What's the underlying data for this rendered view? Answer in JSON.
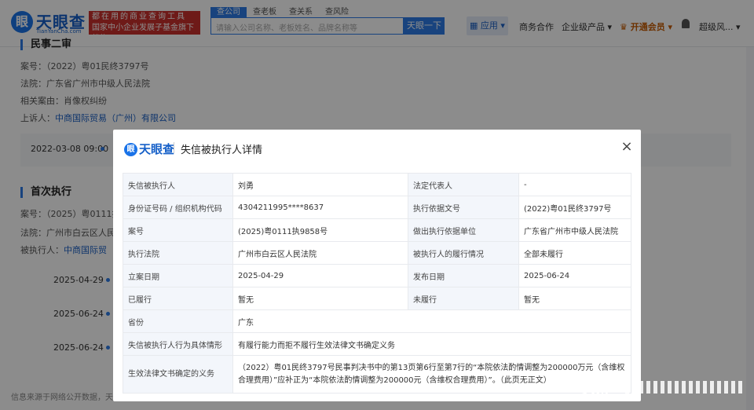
{
  "header": {
    "logo_mark": "眼",
    "logo_text": "天眼查",
    "logo_sub": "TianYanCha.com",
    "slogan_line1": "都在用的商业查询工具",
    "slogan_line2": "国家中小企业发展子基金旗下机构",
    "search_tabs": [
      "查公司",
      "查老板",
      "查关系",
      "查风险"
    ],
    "search_placeholder": "请输入公司名称、老板姓名、品牌名称等",
    "search_button": "天眼一下",
    "nav_apps": "应用",
    "nav_business": "商务合作",
    "nav_enterprise": "企业级产品",
    "nav_vip": "开通会员",
    "nav_user": "超级风..."
  },
  "background": {
    "section1_title": "民事二审",
    "case_no_label": "案号：",
    "case_no": "（2022）粤01民终3797号",
    "court_label": "法院：",
    "court": "广东省广州市中级人民法院",
    "cause_label": "相关案由：",
    "cause": "肖像权纠纷",
    "appellant_label": "上诉人：",
    "appellant": "中商国际贸易（广州）有限公司",
    "time1": "2022-03-08 09:00",
    "section2_title": "首次执行",
    "case_no2": "（2025）粤0111执",
    "court2": "广州市白云区人民",
    "executee_label": "被执行人：",
    "executee": "中商国际贸",
    "dates": [
      "2025-04-29",
      "2025-06-24",
      "2025-06-24"
    ],
    "footer": "信息来源于网络公开数据，天眼查"
  },
  "modal": {
    "logo": "天眼查",
    "title": "失信被执行人详情",
    "close": "×",
    "rows": [
      {
        "k1": "失信被执行人",
        "v1": "刘勇",
        "k2": "法定代表人",
        "v2": "-"
      },
      {
        "k1": "身份证号码 / 组织机构代码",
        "v1": "4304211995****8637",
        "k2": "执行依据文号",
        "v2": "(2022)粤01民终3797号"
      },
      {
        "k1": "案号",
        "v1": "(2025)粤0111执9858号",
        "k2": "做出执行依据单位",
        "v2": "广东省广州市中级人民法院"
      },
      {
        "k1": "执行法院",
        "v1": "广州市白云区人民法院",
        "k2": "被执行人的履行情况",
        "v2": "全部未履行"
      },
      {
        "k1": "立案日期",
        "v1": "2025-04-29",
        "k2": "发布日期",
        "v2": "2025-06-24"
      },
      {
        "k1": "已履行",
        "v1": "暂无",
        "k2": "未履行",
        "v2": "暂无"
      }
    ],
    "province_label": "省份",
    "province": "广东",
    "behavior_label": "失信被执行人行为具体情形",
    "behavior": "有履行能力而拒不履行生效法律文书确定义务",
    "obligation_label": "生效法律文书确定的义务",
    "obligation": "（2022）粤01民终3797号民事判决书中的第13页第6行至第7行的“本院依法酌情调整为200000万元（含维权合理费用）”应补正为“本院依法酌情调整为200000元（含维权合理费用）”。（此页无正文）"
  },
  "watermark": "头条"
}
